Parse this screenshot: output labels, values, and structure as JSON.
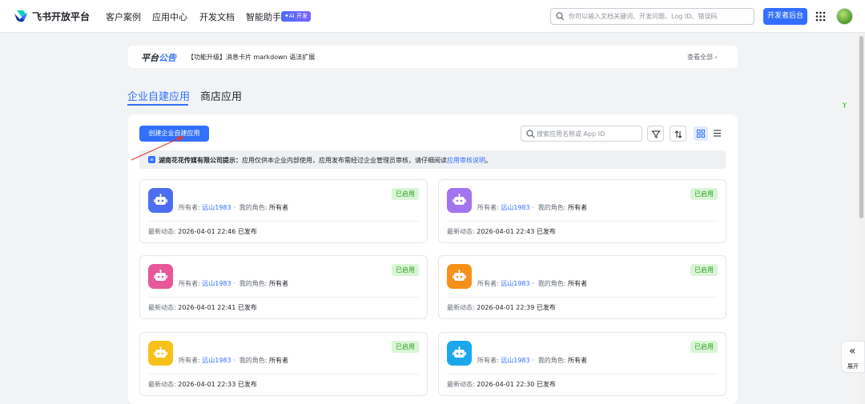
{
  "header": {
    "brand": "飞书开放平台",
    "nav": [
      "客户案例",
      "应用中心",
      "开发文档",
      "智能助手"
    ],
    "ai_badge": "✦AI 开发",
    "search_placeholder": "你可以输入文档关键词、开发问题、Log ID、错误码",
    "dev_console": "开发者后台"
  },
  "announcement": {
    "title_a": "平台",
    "title_b": "公告",
    "text": "【功能升级】消息卡片 markdown 语法扩展",
    "more": "查看全部 ›"
  },
  "tabs": [
    "企业自建应用",
    "商店应用"
  ],
  "toolbar": {
    "create": "创建企业自建应用",
    "search_placeholder": "搜索应用名称或 App ID"
  },
  "notice": {
    "company": "湖南花花传媒有限公司提示：",
    "text": "应用仅供本企业内部使用，应用发布需经过企业管理员审核，请仔细阅读",
    "link": "应用审核说明",
    "end": "。"
  },
  "cards": [
    {
      "color": "#4e6ef2",
      "status": "已启用",
      "owner_label": "所有者:",
      "owner": "远山1983",
      "role_label": "我的角色:",
      "role": "所有者",
      "latest_label": "最新动态:",
      "latest": "2026-04-01 22:46 已发布"
    },
    {
      "color": "#a374f0",
      "status": "已启用",
      "owner_label": "所有者:",
      "owner": "远山1983",
      "role_label": "我的角色:",
      "role": "所有者",
      "latest_label": "最新动态:",
      "latest": "2026-04-01 22:43 已发布"
    },
    {
      "color": "#e8579a",
      "status": "已启用",
      "owner_label": "所有者:",
      "owner": "远山1983",
      "role_label": "我的角色:",
      "role": "所有者",
      "latest_label": "最新动态:",
      "latest": "2026-04-01 22:41 已发布"
    },
    {
      "color": "#f5901a",
      "status": "已启用",
      "owner_label": "所有者:",
      "owner": "远山1983",
      "role_label": "我的角色:",
      "role": "所有者",
      "latest_label": "最新动态:",
      "latest": "2026-04-01 22:39 已发布"
    },
    {
      "color": "#f7c01b",
      "status": "已启用",
      "owner_label": "所有者:",
      "owner": "远山1983",
      "role_label": "我的角色:",
      "role": "所有者",
      "latest_label": "最新动态:",
      "latest": "2026-04-01 22:33 已发布"
    },
    {
      "color": "#1aa7ec",
      "status": "已启用",
      "owner_label": "所有者:",
      "owner": "远山1983",
      "role_label": "我的角色:",
      "role": "所有者",
      "latest_label": "最新动态:",
      "latest": "2026-04-01 22:30 已发布"
    }
  ],
  "side": {
    "expand": "展开"
  }
}
